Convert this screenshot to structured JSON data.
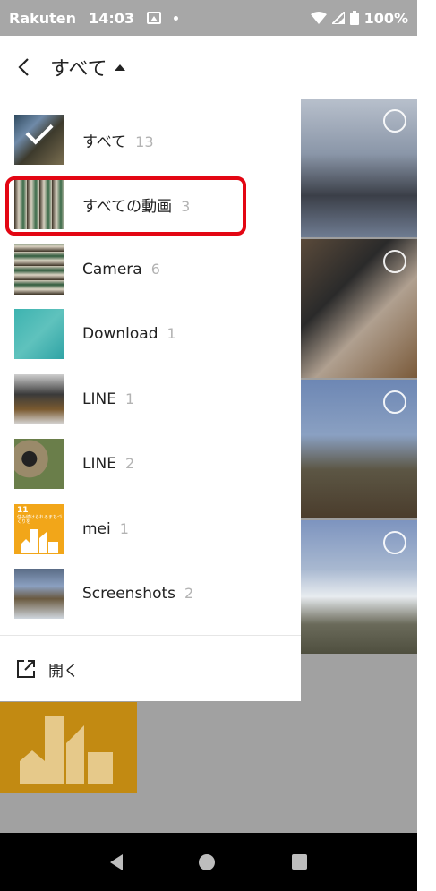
{
  "status_bar": {
    "carrier": "Rakuten",
    "time": "14:03",
    "battery": "100%"
  },
  "header": {
    "title": "すべて"
  },
  "albums": [
    {
      "name": "すべて",
      "count": "13",
      "selected": true,
      "thumb": "th-all"
    },
    {
      "name": "すべての動画",
      "count": "3",
      "highlighted": true,
      "thumb": "th-video"
    },
    {
      "name": "Camera",
      "count": "6",
      "thumb": "th-camera"
    },
    {
      "name": "Download",
      "count": "1",
      "thumb": "th-download"
    },
    {
      "name": "LINE",
      "count": "1",
      "thumb": "th-line1"
    },
    {
      "name": "LINE",
      "count": "2",
      "thumb": "th-line2"
    },
    {
      "name": "mei",
      "count": "1",
      "thumb": "th-mei"
    },
    {
      "name": "Screenshots",
      "count": "2",
      "thumb": "th-ss"
    }
  ],
  "mei_thumb_text": "11",
  "mei_thumb_subtext": "住み続けられるまちづくりを",
  "open_action": {
    "label": "開く"
  },
  "colors": {
    "highlight": "#e30613",
    "mei_orange": "#f2a619"
  }
}
